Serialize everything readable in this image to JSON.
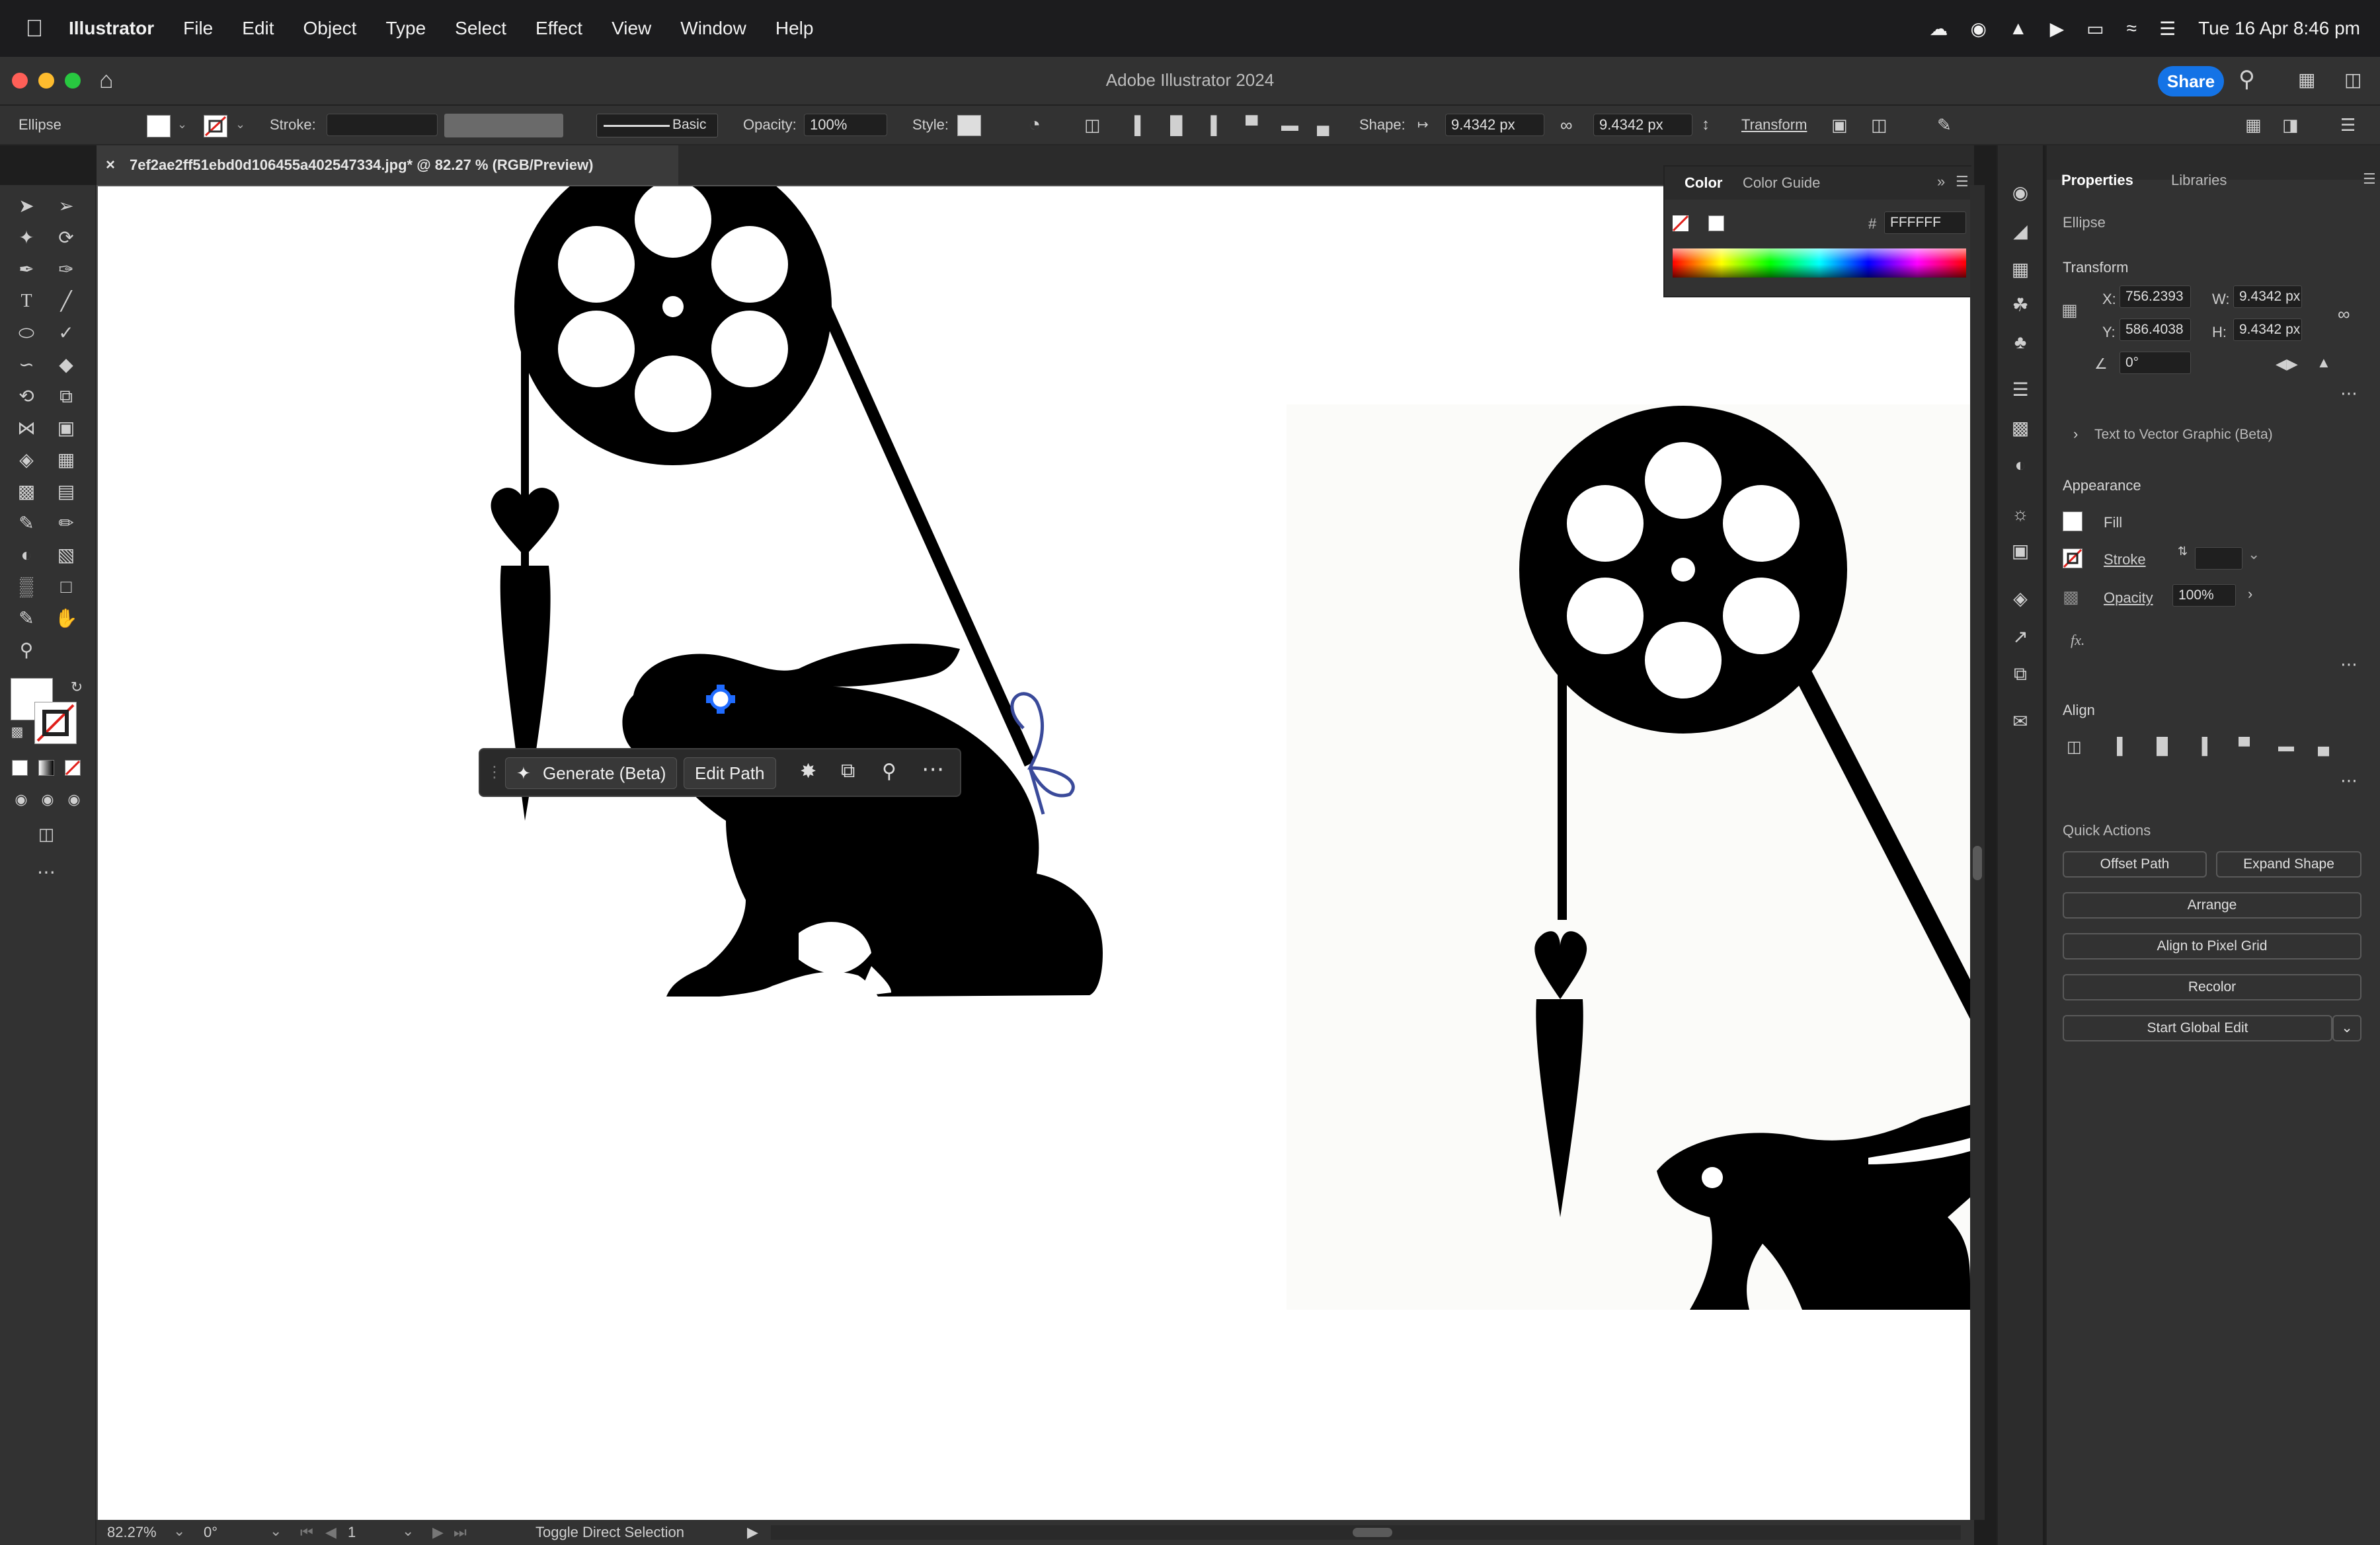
{
  "menubar": {
    "app_name": "Illustrator",
    "items": [
      "File",
      "Edit",
      "Object",
      "Type",
      "Select",
      "Effect",
      "View",
      "Window",
      "Help"
    ],
    "datetime": "Tue 16 Apr  8:46 pm"
  },
  "titlebar": {
    "title": "Adobe Illustrator 2024",
    "share_label": "Share"
  },
  "control_bar": {
    "object_type": "Ellipse",
    "stroke_label": "Stroke:",
    "brush_label": "Basic",
    "opacity_label": "Opacity:",
    "opacity_value": "100%",
    "style_label": "Style:",
    "shape_label": "Shape:",
    "width_value": "9.4342 px",
    "height_value": "9.4342 px",
    "transform_label": "Transform"
  },
  "document_tab": {
    "title": "7ef2ae2ff51ebd0d106455a402547334.jpg* @ 82.27 % (RGB/Preview)"
  },
  "context_bar": {
    "generate_label": "Generate (Beta)",
    "edit_path_label": "Edit Path"
  },
  "color_panel": {
    "tab_color": "Color",
    "tab_guide": "Color Guide",
    "hex_value": "FFFFFF"
  },
  "properties": {
    "tab_properties": "Properties",
    "tab_libraries": "Libraries",
    "object_type": "Ellipse",
    "transform_title": "Transform",
    "x_label": "X:",
    "x_value": "756.2393",
    "y_label": "Y:",
    "y_value": "586.4038",
    "w_label": "W:",
    "w_value": "9.4342 px",
    "h_label": "H:",
    "h_value": "9.4342 px",
    "angle_value": "0°",
    "text_to_vector": "Text to Vector Graphic (Beta)",
    "appearance_title": "Appearance",
    "fill_label": "Fill",
    "stroke_label": "Stroke",
    "opacity_label": "Opacity",
    "opacity_value": "100%",
    "fx_label": "fx.",
    "align_title": "Align",
    "quick_actions_title": "Quick Actions",
    "offset_path": "Offset Path",
    "expand_shape": "Expand Shape",
    "arrange": "Arrange",
    "align_pixel": "Align to Pixel Grid",
    "recolor": "Recolor",
    "global_edit": "Start Global Edit"
  },
  "statusbar": {
    "zoom": "82.27%",
    "rotation": "0°",
    "artboard": "1",
    "status_text": "Toggle Direct Selection"
  },
  "colors": {
    "accent": "#1473e6",
    "panel_bg": "#323232",
    "canvas_bg": "#ffffff"
  },
  "icons": [
    "apple-icon",
    "home-icon",
    "search-icon",
    "selection-tool-icon",
    "direct-selection-tool-icon",
    "pen-tool-icon",
    "type-tool-icon",
    "ellipse-tool-icon",
    "zoom-tool-icon",
    "hand-tool-icon",
    "lock-icon",
    "more-icon"
  ]
}
